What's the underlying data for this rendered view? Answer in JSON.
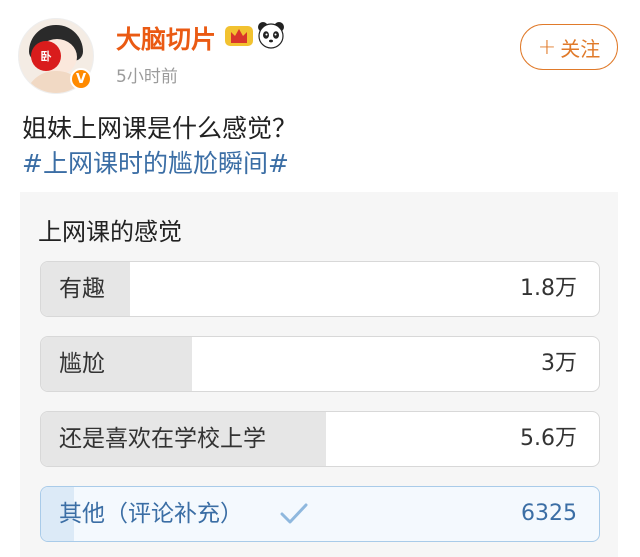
{
  "post": {
    "username": "大脑切片",
    "timestamp": "5小时前",
    "follow_label": "关注",
    "follow_icon": "plus-icon",
    "avatar_text": "卧",
    "verified_badge": "V",
    "text": "姐妹上网课是什么感觉？",
    "hashtag": "#上网课时的尴尬瞬间#"
  },
  "poll": {
    "title": "上网课的感觉",
    "options": [
      {
        "label": "有趣",
        "count": "1.8万",
        "share": 0.16
      },
      {
        "label": "尴尬",
        "count": "3万",
        "share": 0.27
      },
      {
        "label": "还是喜欢在学校上学",
        "count": "5.6万",
        "share": 0.51
      },
      {
        "label": "其他（评论补充）",
        "count": "6325",
        "share": 0.06,
        "selected": true
      }
    ]
  },
  "colors": {
    "username": "#ea5a13",
    "follow": "#e07a2a",
    "hashtag": "#3b6ea5",
    "selected": "#3b6ea5",
    "verified": "#ff8a00"
  }
}
